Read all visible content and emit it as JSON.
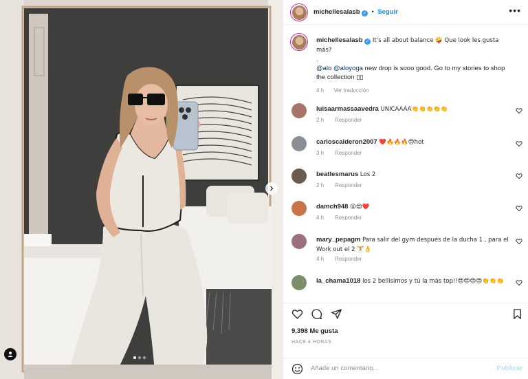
{
  "post": {
    "username": "michellesalasb",
    "follow_label": "Seguir",
    "more_label": "•••",
    "caption": {
      "main": "It's all about balance 🤪 Que look les gusta más?",
      "dot": ".",
      "mention1": "@alo",
      "mention2": "@aloyoga",
      "body": " new drop is sooo good. Go to my stories to shop the collection ▯▯",
      "time": "4 h",
      "translate": "Ver traducción"
    },
    "likes": "9,398 Me gusta",
    "posted_ago": "HACE 4 HORAS",
    "add_comment_placeholder": "Añade un comentario...",
    "publish_label": "Publicar"
  },
  "comments": [
    {
      "user": "luisaarmassaavedra",
      "text": "UNICAAAA👏👏👏👏👏",
      "time": "2 h",
      "reply": "Responder",
      "avatar_color": "#a7746a"
    },
    {
      "user": "carloscalderon2007",
      "text": "❤️🔥🔥🔥😍hot",
      "time": "3 h",
      "reply": "Responder",
      "avatar_color": "#8a8f95"
    },
    {
      "user": "beatlesmarus",
      "text": "Los 2",
      "time": "2 h",
      "reply": "Responder",
      "avatar_color": "#6b5a4e"
    },
    {
      "user": "damch948",
      "text": "😮😍❤️",
      "time": "4 h",
      "reply": "Responder",
      "avatar_color": "#c8734a"
    },
    {
      "user": "mary_pepagm",
      "text": "Para salir del gym después de la ducha 1 , para el Work out el 2 🏋️👌",
      "time": "4 h",
      "reply": "Responder",
      "avatar_color": "#9b6f7b"
    },
    {
      "user": "la_chama1018",
      "text": "los 2 bellisimos y tú la más top!!😍😍😍😍👏👏👏",
      "time": "",
      "reply": "",
      "avatar_color": "#7d8c6a"
    }
  ],
  "colors": {
    "accent": "#0095f6",
    "verified": "#3897f0",
    "heart_red": "#ed4956"
  },
  "icons": {
    "like": "heart-icon",
    "comment": "comment-icon",
    "share": "paper-plane-icon",
    "save": "bookmark-icon",
    "next": "chevron-right-icon",
    "tag": "person-tag-icon",
    "emoji": "smiley-icon"
  }
}
